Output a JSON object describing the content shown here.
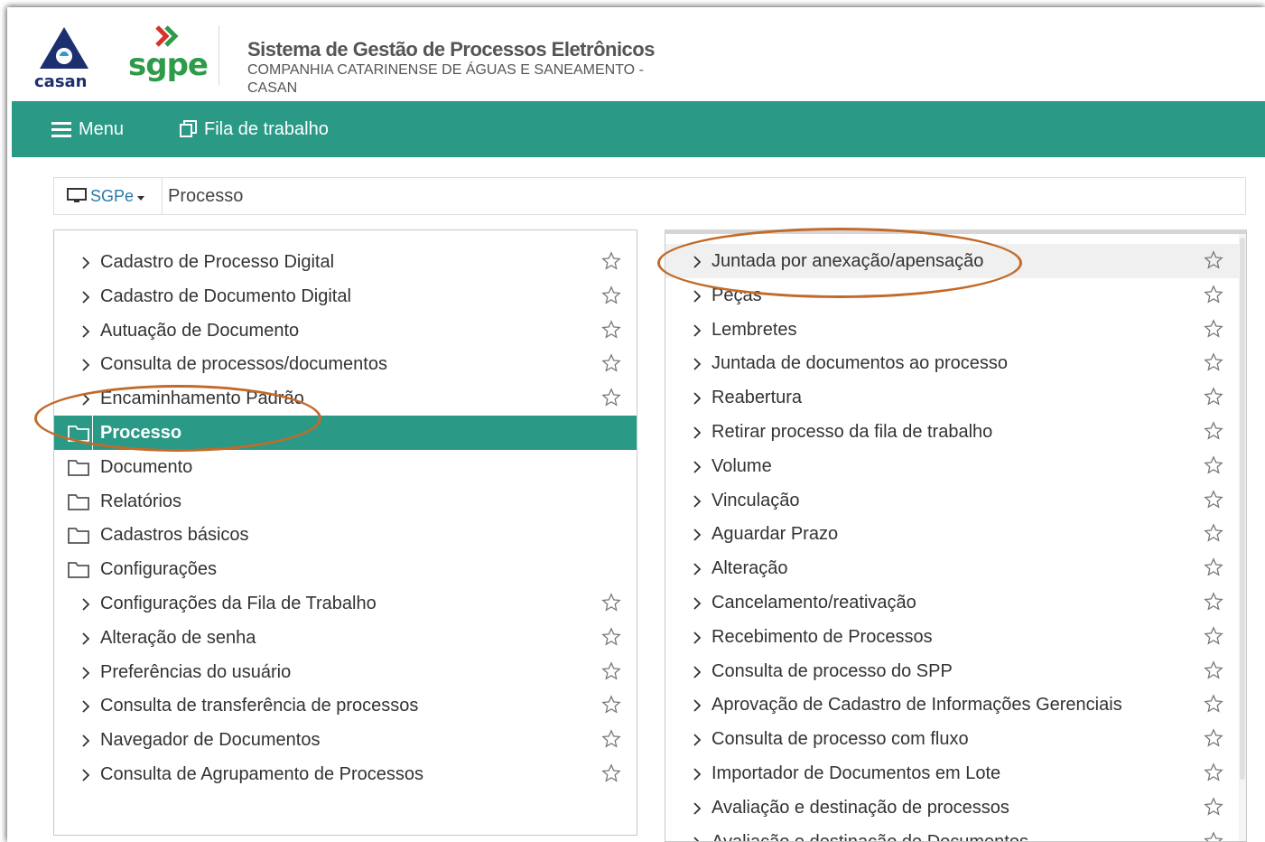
{
  "header": {
    "casan_logo_text": "casan",
    "sgpe_logo_text": "sgpe",
    "system_title": "Sistema de Gestão de Processos Eletrônicos",
    "company_name": "COMPANHIA CATARINENSE DE ÁGUAS E SANEAMENTO - CASAN"
  },
  "navbar": {
    "menu_label": "Menu",
    "fila_label": "Fila de trabalho",
    "background": "#2a9a87"
  },
  "breadcrumb": {
    "system": "SGPe",
    "page": "Processo"
  },
  "left_panel": {
    "items": [
      {
        "label": "Cadastro de Processo Digital",
        "type": "item"
      },
      {
        "label": "Cadastro de Documento Digital",
        "type": "item"
      },
      {
        "label": "Autuação de Documento",
        "type": "item"
      },
      {
        "label": "Consulta de processos/documentos",
        "type": "item"
      },
      {
        "label": "Encaminhamento Padrão",
        "type": "item"
      },
      {
        "label": "Processo",
        "type": "folder",
        "active": true
      },
      {
        "label": "Documento",
        "type": "folder"
      },
      {
        "label": "Relatórios",
        "type": "folder"
      },
      {
        "label": "Cadastros básicos",
        "type": "folder"
      },
      {
        "label": "Configurações",
        "type": "folder"
      },
      {
        "label": "Configurações da Fila de Trabalho",
        "type": "item"
      },
      {
        "label": "Alteração de senha",
        "type": "item"
      },
      {
        "label": "Preferências do usuário",
        "type": "item"
      },
      {
        "label": "Consulta de transferência de processos",
        "type": "item"
      },
      {
        "label": "Navegador de Documentos",
        "type": "item"
      },
      {
        "label": "Consulta de Agrupamento de Processos",
        "type": "item"
      }
    ]
  },
  "right_panel": {
    "items": [
      {
        "label": "Juntada por anexação/apensação",
        "hover": true
      },
      {
        "label": "Peças"
      },
      {
        "label": "Lembretes"
      },
      {
        "label": "Juntada de documentos ao processo"
      },
      {
        "label": "Reabertura"
      },
      {
        "label": "Retirar processo da fila de trabalho"
      },
      {
        "label": "Volume"
      },
      {
        "label": "Vinculação"
      },
      {
        "label": "Aguardar Prazo"
      },
      {
        "label": "Alteração"
      },
      {
        "label": "Cancelamento/reativação"
      },
      {
        "label": "Recebimento de Processos"
      },
      {
        "label": "Consulta de processo do SPP"
      },
      {
        "label": "Aprovação de Cadastro de Informações Gerenciais"
      },
      {
        "label": "Consulta de processo com fluxo"
      },
      {
        "label": "Importador de Documentos em Lote"
      },
      {
        "label": "Avaliação e destinação de processos"
      },
      {
        "label": "Avaliação e destinação de Documentos"
      }
    ]
  },
  "colors": {
    "accent": "#2a9a87",
    "annotation": "#c26a2a",
    "link": "#2a7aa8"
  }
}
